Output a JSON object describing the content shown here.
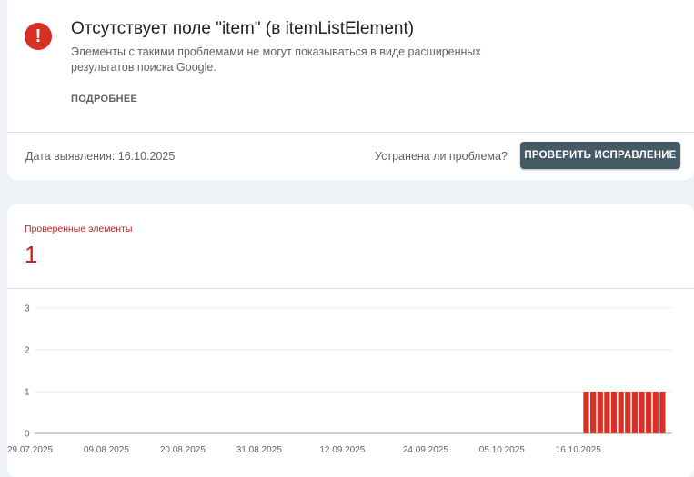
{
  "issue": {
    "icon": "error-icon",
    "icon_glyph": "!",
    "accent_color": "#d93025",
    "title": "Отсутствует поле \"item\" (в itemListElement)",
    "description": "Элементы с такими проблемами не могут показываться в виде расширенных результатов поиска Google.",
    "more_link": "ПОДРОБНЕЕ",
    "detection_date": "Дата выявления: 16.10.2025",
    "fixed_question": "Устранена ли проблема?",
    "validate_button": "ПРОВЕРИТЬ ИСПРАВЛЕНИЕ",
    "button_color": "#455a64"
  },
  "metric": {
    "label": "Проверенные элементы",
    "value": "1",
    "color": "#c5221f"
  },
  "chart_data": {
    "type": "bar",
    "x_tick_labels": [
      "29.07.2025",
      "09.08.2025",
      "20.08.2025",
      "31.08.2025",
      "12.09.2025",
      "24.09.2025",
      "05.10.2025",
      "16.10.2025"
    ],
    "y_ticks": [
      0,
      1,
      2,
      3
    ],
    "ylim": [
      0,
      3
    ],
    "grid": true,
    "bar_color": "#d93025",
    "x_start": "2025-07-29",
    "series": [
      {
        "dates": [
          "2025-10-16",
          "2025-10-17",
          "2025-10-18",
          "2025-10-19",
          "2025-10-20",
          "2025-10-21",
          "2025-10-22",
          "2025-10-23",
          "2025-10-24",
          "2025-10-25",
          "2025-10-26",
          "2025-10-27"
        ],
        "values": [
          1,
          1,
          1,
          1,
          1,
          1,
          1,
          1,
          1,
          1,
          1,
          1
        ]
      }
    ]
  }
}
